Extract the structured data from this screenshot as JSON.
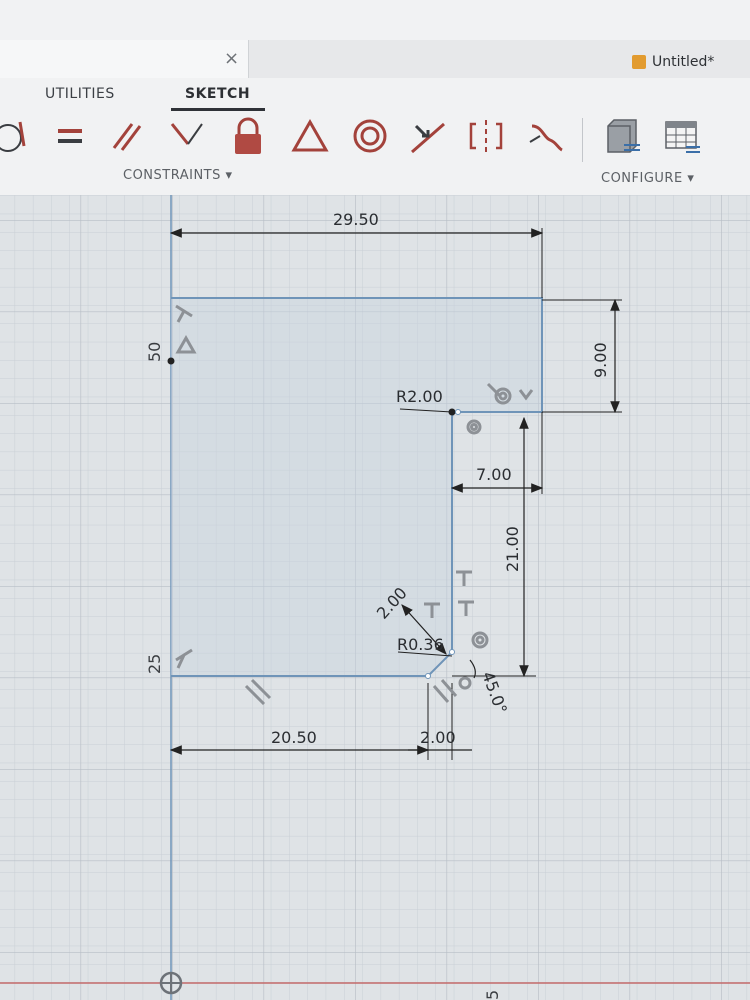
{
  "window": {
    "title": "Untitled*",
    "close_glyph": "×"
  },
  "tabs": {
    "utilities": "UTILITIES",
    "sketch": "SKETCH"
  },
  "toolbar": {
    "constraints_label": "CONSTRAINTS ▾",
    "configure_label": "CONFIGURE ▾",
    "constraint_icons": [
      "tangent-icon",
      "equal-icon",
      "parallel-icon",
      "perpendicular-icon",
      "fix-lock-icon",
      "horizontal-vertical-icon",
      "concentric-icon",
      "midpoint-icon",
      "symmetry-icon",
      "curvature-icon"
    ],
    "configure_icons": [
      "sketch-palette-icon",
      "table-icon"
    ]
  },
  "dimensions": {
    "top_width": "29.50",
    "right_height": "9.00",
    "fillet_radius": "R2.00",
    "inner_width": "7.00",
    "inner_height": "21.00",
    "chamfer_length": "2.00",
    "small_radius": "R0.36",
    "angle": "45.0°",
    "bottom_left": "20.50",
    "bottom_gap": "2.00",
    "axis_label_top": "50",
    "axis_label_bottom": "25",
    "axis_label_corner": "5"
  },
  "colors": {
    "sketch_line": "#6f94b8",
    "profile_fill": "#c7d3de",
    "constraint_red": "#a3423b",
    "dimension_line": "#222222",
    "axis_red": "#c46a6a"
  }
}
